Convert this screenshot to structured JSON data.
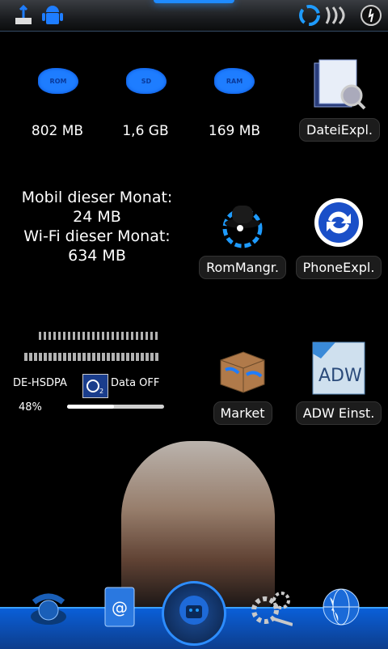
{
  "storage": [
    {
      "tag": "ROM",
      "value": "802 MB"
    },
    {
      "tag": "SD",
      "value": "1,6 GB"
    },
    {
      "tag": "RAM",
      "value": "169 MB"
    }
  ],
  "apps": {
    "datei": "DateiExpl.",
    "rom": "RomMangr.",
    "phone": "PhoneExpl.",
    "market": "Market",
    "adw": "ADW Einst."
  },
  "data_usage": {
    "mobile_label": "Mobil dieser Monat:",
    "mobile_value": "24 MB",
    "wifi_label": "Wi-Fi dieser Monat:",
    "wifi_value": "634 MB"
  },
  "network": {
    "type": "DE-HSDPA",
    "data_status": "Data OFF",
    "battery_pct": "48%",
    "battery_fraction": 0.48
  },
  "colors": {
    "accent": "#1e7dff",
    "dock": "#0a5fd8"
  },
  "icons": {
    "statusbar_left": [
      "usb-icon",
      "android-icon"
    ],
    "statusbar_right": [
      "sync-icon",
      "signal-icon",
      "power-icon"
    ],
    "dock": [
      "phone-icon",
      "contacts-icon",
      "app-drawer-icon",
      "settings-icon",
      "browser-globe-icon"
    ]
  }
}
